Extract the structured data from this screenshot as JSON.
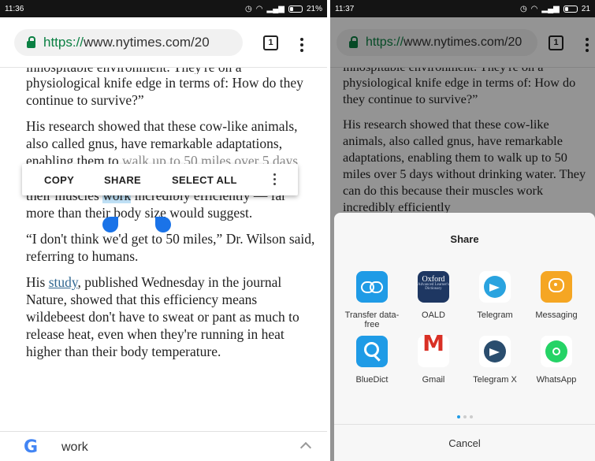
{
  "left": {
    "status": {
      "time": "11:36",
      "battery": "21%"
    },
    "url": {
      "scheme": "https://",
      "host": "www.nytimes.com/20"
    },
    "tab_count": "1",
    "article": {
      "cut_line": "inhospitable environment.  They're on a",
      "p1": "physiological knife edge in terms of: How do they continue to survive?”",
      "p2a": "His research showed that these cow-like animals, also called gnus, have remarkable adaptations, enabling them to",
      "p2b": "walk up to 50 miles over 5 days without drinking water. They can do this because",
      "p2c": "their muscles ",
      "p2_selected": "work",
      "p2d": " incredibly efficiently — far more than their body size would suggest.",
      "p3": "“I don't think we'd get to 50 miles,” Dr. Wilson said, referring to humans.",
      "p4a": "His ",
      "p4_link": "study",
      "p4b": ", published Wednesday in the journal Nature, showed that this efficiency means wildebeest don't have to sweat or pant as much to release heat, even when they're running in heat higher than their body temperature."
    },
    "toolbar": {
      "copy": "COPY",
      "share": "SHARE",
      "select_all": "SELECT ALL"
    },
    "search_bar": {
      "logo": "G",
      "term": "work"
    }
  },
  "right": {
    "status": {
      "time": "11:37",
      "battery": "21"
    },
    "url": {
      "scheme": "https://",
      "host": "www.nytimes.com/20"
    },
    "tab_count": "1",
    "article": {
      "cut_line": "inhospitable environment.  They're on a",
      "p1": "physiological knife edge in terms of: How do they continue to survive?”",
      "p2": "His research showed that these cow-like animals, also called gnus, have remarkable adaptations, enabling them to walk up to 50 miles over 5 days without drinking water. They can do this because their muscles work incredibly efficiently"
    },
    "share_sheet": {
      "title": "Share",
      "apps": [
        {
          "label": "Transfer data-free",
          "icon": "transfer-icon"
        },
        {
          "label": "OALD",
          "icon": "oald-icon"
        },
        {
          "label": "Telegram",
          "icon": "telegram-icon"
        },
        {
          "label": "Messaging",
          "icon": "messaging-icon"
        },
        {
          "label": "BlueDict",
          "icon": "bluedict-icon"
        },
        {
          "label": "Gmail",
          "icon": "gmail-icon"
        },
        {
          "label": "Telegram X",
          "icon": "telegram-x-icon"
        },
        {
          "label": "WhatsApp",
          "icon": "whatsapp-icon"
        }
      ],
      "oald_icon_text": {
        "line1": "Oxford",
        "line2": "Advanced Learner's Dictionary"
      },
      "cancel": "Cancel"
    }
  },
  "colors": {
    "accent_green": "#0b8043",
    "selection": "#bfe0f5",
    "handle_blue": "#1a73e8",
    "link": "#326891"
  }
}
